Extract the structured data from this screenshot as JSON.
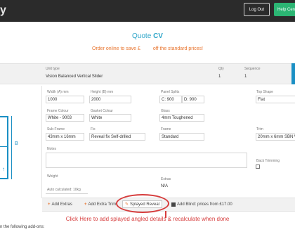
{
  "topbar": {
    "logo_fragment": "y",
    "logout_label": "Log Out",
    "help_label": "Help Cen"
  },
  "quote": {
    "title_prefix": "Quote",
    "title_code": "CV"
  },
  "promo": {
    "part1": "Order online to save £",
    "part2": "off the standard prices!"
  },
  "header_row": {
    "unit_type_label": "Unit type",
    "unit_type_value": "Vision Balanced Vertical Slider",
    "qty_label": "Qty",
    "qty_value": "1",
    "sequence_label": "Sequence",
    "sequence_value": "1"
  },
  "form": {
    "width_label": "Width (A) mm",
    "width_value": "1000",
    "height_label": "Height (B) mm",
    "height_value": "2000",
    "panel_splits_label": "Panel Splits",
    "panel_splits_c": "C: 900",
    "panel_splits_d": "D: 900",
    "top_shape_label": "Top Shape",
    "top_shape_value": "Flat",
    "frame_colour_label": "Frame Colour",
    "frame_colour_value": "White - 9003",
    "gasket_colour_label": "Gasket Colour",
    "gasket_colour_value": "White",
    "glass_label": "Glass",
    "glass_value": "4mm Toughened",
    "sub_frame_label": "Sub-Frame",
    "sub_frame_value": "43mm x 16mm",
    "fix_label": "Fix",
    "fix_value": "Reveal fix Self-drilled",
    "frame_label": "Frame",
    "frame_value": "Standard",
    "trim_label": "Trim",
    "trim_value": "20mm x 6mm SBN W",
    "notes_label": "Notes",
    "back_trimming_label": "Back Trimming",
    "weight_label": "Weight",
    "weight_auto": "Auto calculated: 10kg",
    "extras_label": "Extras",
    "extras_value": "N/A"
  },
  "diagram": {
    "b_label": "B"
  },
  "actions": {
    "add_extras": "Add Extras",
    "add_extra_trim": "Add Extra Trim",
    "splayed_reveal": "Splayed Reveal",
    "add_blind": "Add Blind: prices from £17.00"
  },
  "annotation": {
    "text": "Click Here to add splayed angled details & recalculate when done"
  },
  "footer": {
    "addons_text": "n the following add-ons:"
  },
  "colors": {
    "accent_blue": "#1a8fc4",
    "promo_orange": "#e8732c",
    "annotation_red": "#d63c3c",
    "help_green": "#2bb573"
  }
}
